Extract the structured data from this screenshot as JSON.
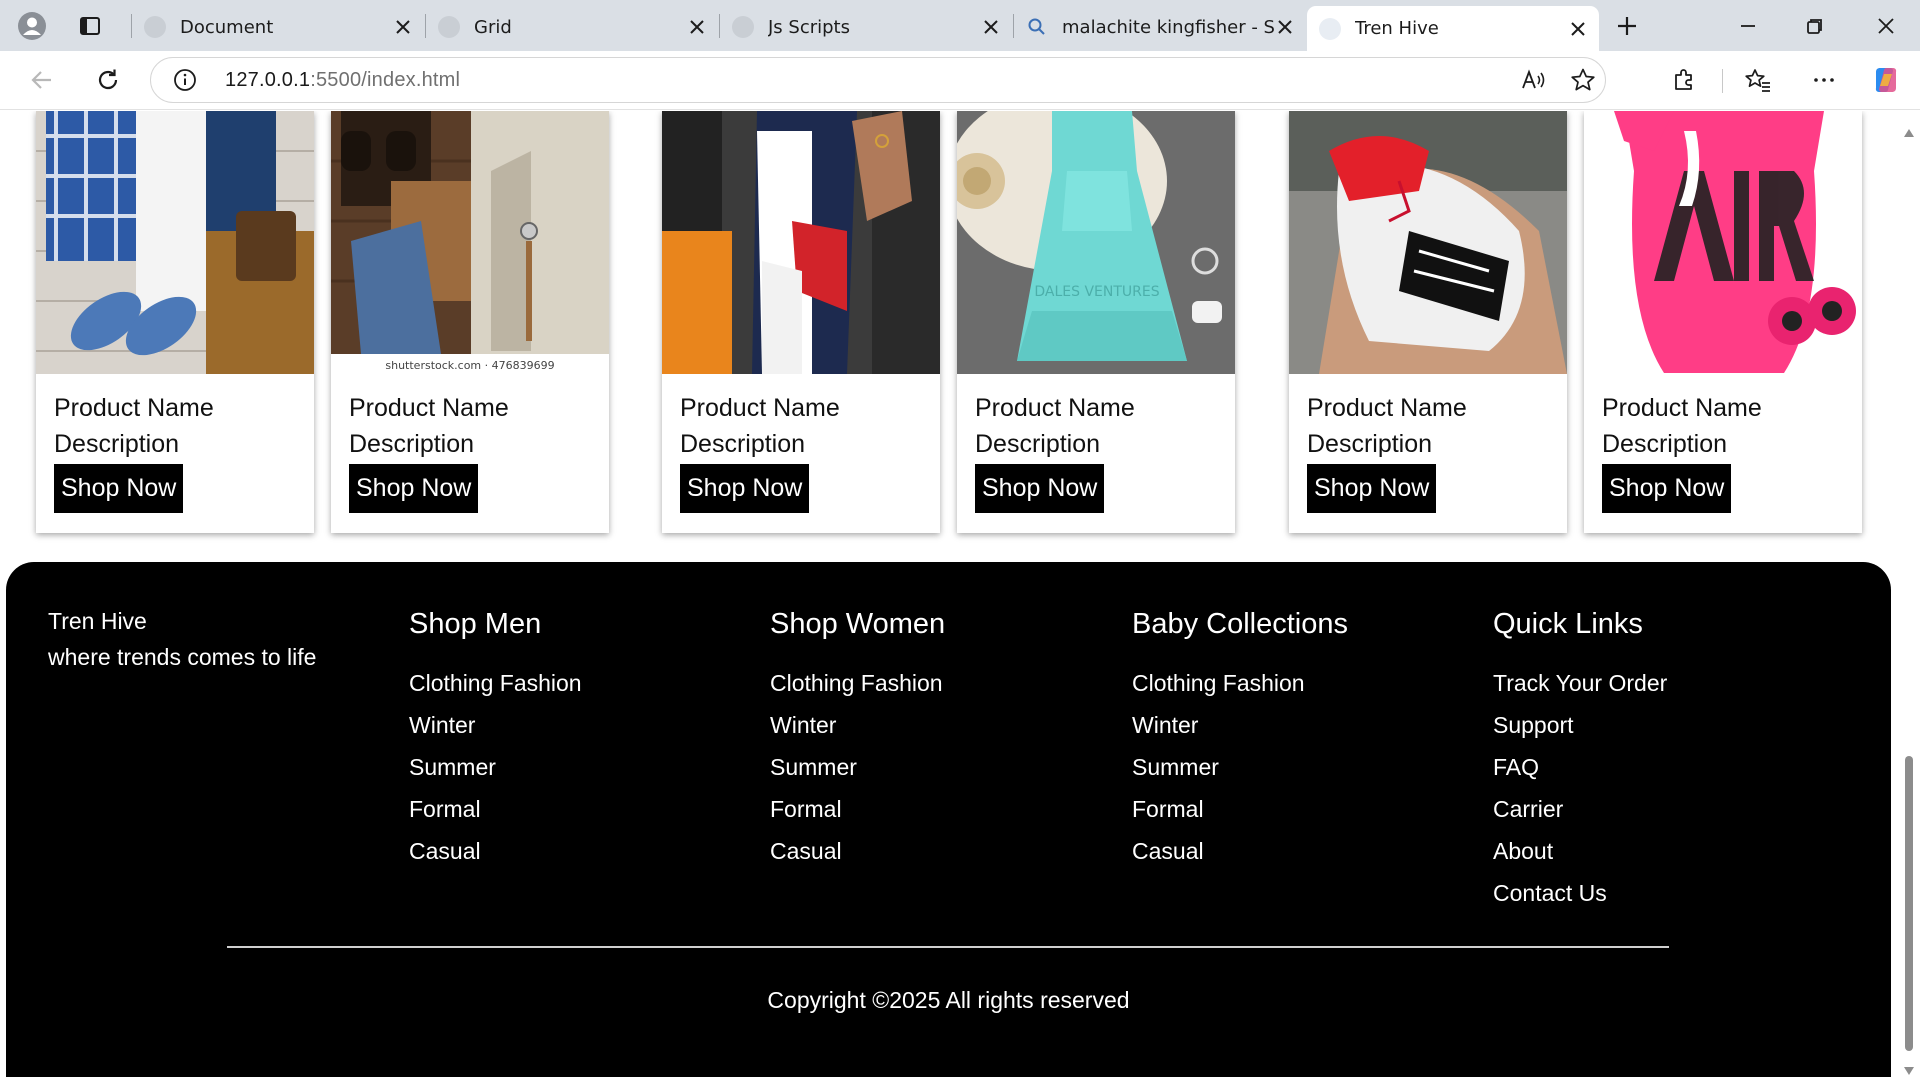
{
  "browser": {
    "tabs": [
      {
        "title": "Document",
        "icon": "page-favicon"
      },
      {
        "title": "Grid",
        "icon": "page-favicon"
      },
      {
        "title": "Js Scripts",
        "icon": "page-favicon"
      },
      {
        "title": "malachite kingfisher - Sea",
        "icon": "search-icon"
      },
      {
        "title": "Tren Hive",
        "icon": "page-favicon",
        "active": true
      }
    ],
    "url_host": "127.0.0.1",
    "url_rest": ":5500/index.html"
  },
  "products": [
    {
      "name": "Product Name",
      "description": "Description",
      "button": "Shop Now",
      "image": "men-casual-outfit"
    },
    {
      "name": "Product Name",
      "description": "Description",
      "button": "Shop Now",
      "image": "men-formal-outfit",
      "watermark": "shutterstock.com · 476839699"
    },
    {
      "name": "Product Name",
      "description": "Description",
      "button": "Shop Now",
      "image": "women-color-block-dress"
    },
    {
      "name": "Product Name",
      "description": "Description",
      "button": "Shop Now",
      "image": "women-aqua-maxi-dress",
      "watermark": "DALES VENTURES"
    },
    {
      "name": "Product Name",
      "description": "Description",
      "button": "Shop Now",
      "image": "baby-sneaker"
    },
    {
      "name": "Product Name",
      "description": "Description",
      "button": "Shop Now",
      "image": "baby-onesie-pink"
    }
  ],
  "footer": {
    "brand": "Tren Hive",
    "tagline": "where trends comes to life",
    "columns": [
      {
        "title": "Shop Men",
        "links": [
          "Clothing Fashion",
          "Winter",
          "Summer",
          "Formal",
          "Casual"
        ]
      },
      {
        "title": "Shop Women",
        "links": [
          "Clothing Fashion",
          "Winter",
          "Summer",
          "Formal",
          "Casual"
        ]
      },
      {
        "title": "Baby Collections",
        "links": [
          "Clothing Fashion",
          "Winter",
          "Summer",
          "Formal",
          "Casual"
        ]
      },
      {
        "title": "Quick Links",
        "links": [
          "Track Your Order",
          "Support",
          "FAQ",
          "Carrier",
          "About",
          "Contact Us"
        ]
      }
    ],
    "copyright": "Copyright ©2025 All rights reserved"
  },
  "colors": {
    "footer_bg": "#000000",
    "button_bg": "#000000",
    "tabbar_bg": "#dadfe5"
  }
}
